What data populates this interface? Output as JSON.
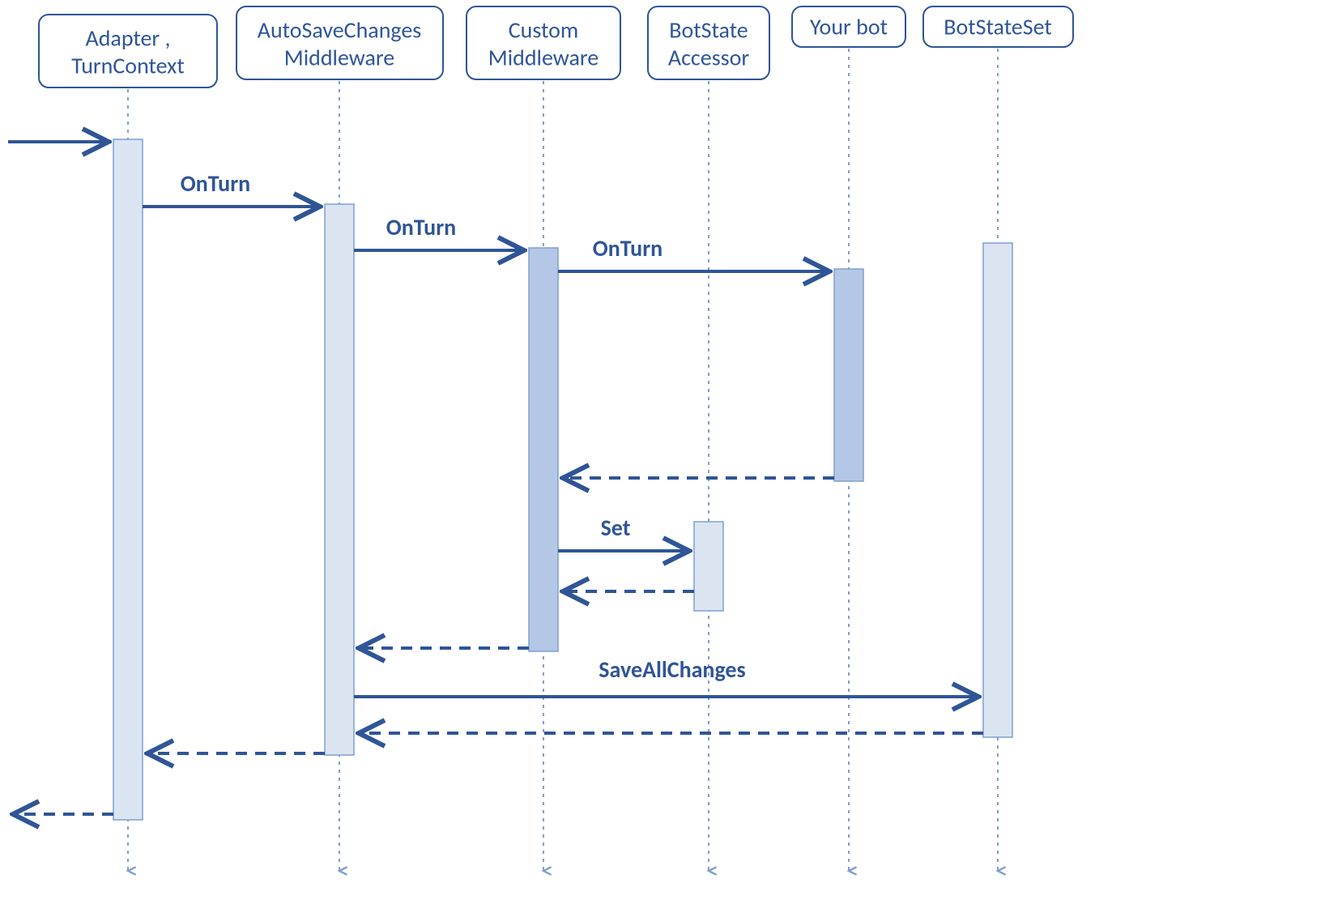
{
  "diagram_type": "sequence",
  "participants": {
    "adapter": {
      "line1": "Adapter ,",
      "line2": "TurnContext"
    },
    "autosave": {
      "line1": "AutoSaveChanges",
      "line2": "Middleware"
    },
    "custom": {
      "line1": "Custom",
      "line2": "Middleware"
    },
    "accessor": {
      "line1": "BotState",
      "line2": "Accessor"
    },
    "yourbot": {
      "line1": "Your bot"
    },
    "botstateset": {
      "line1": "BotStateSet"
    }
  },
  "messages": {
    "onturn1": "OnTurn",
    "onturn2": "OnTurn",
    "onturn3": "OnTurn",
    "set": "Set",
    "saveall": "SaveAllChanges"
  },
  "colors": {
    "primary": "#2f5597",
    "light_fill": "#dbe5f1",
    "dark_fill": "#b4c7e7",
    "lifeline": "#7f9fd1"
  }
}
